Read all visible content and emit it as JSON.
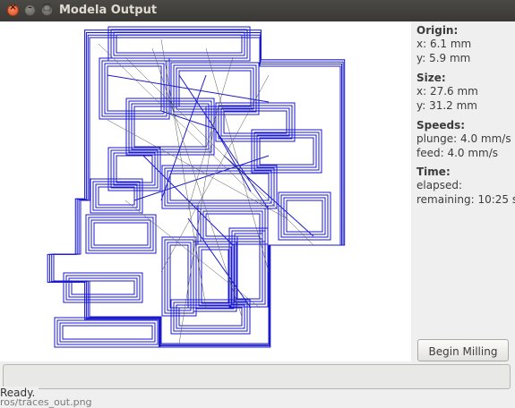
{
  "window": {
    "title": "Modela Output",
    "close_glyph": "×",
    "minimize_glyph": "–",
    "maximize_glyph": "□"
  },
  "toolpath": {
    "path_color": "#1a1acc",
    "move_color": "#555555",
    "background": "#ffffff"
  },
  "info": {
    "origin": {
      "heading": "Origin:",
      "x": "x: 6.1 mm",
      "y": "y: 5.9 mm"
    },
    "size": {
      "heading": "Size:",
      "x": "x: 27.6 mm",
      "y": "y: 31.2 mm"
    },
    "speeds": {
      "heading": "Speeds:",
      "plunge": "plunge: 4.0 mm/s",
      "feed": "feed: 4.0 mm/s"
    },
    "time": {
      "heading": "Time:",
      "elapsed": "elapsed:",
      "remaining": "remaining: 10:25 s"
    }
  },
  "actions": {
    "begin_milling": "Begin Milling"
  },
  "background_window_text": "ros/traces_out.png",
  "status": "Ready."
}
